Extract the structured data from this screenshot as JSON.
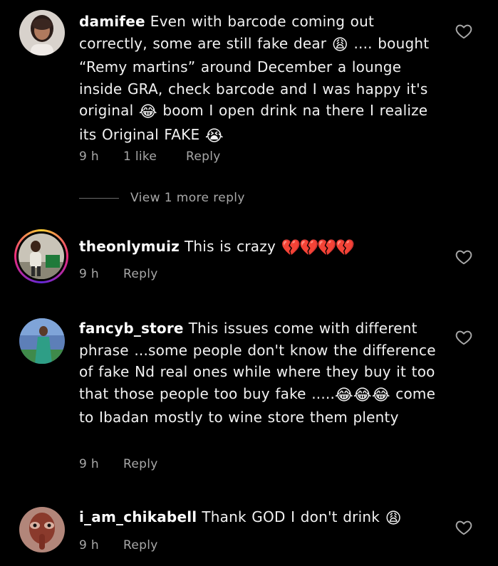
{
  "comments": [
    {
      "username": "damifee",
      "text": "Even with barcode coming out correctly, some are still fake dear",
      "emoji1": "😩",
      "text2": " .... bought “Remy martins” around December a lounge inside GRA, check barcode and I was happy it's original",
      "emoji2": "😂",
      "text3": " boom I open drink na there I realize its Original FAKE ",
      "emoji3": "😭",
      "time": "9 h",
      "likes": "1 like",
      "reply": "Reply"
    },
    {
      "username": "theonlymuiz",
      "text": "This is crazy ",
      "emoji1": "💔💔💔💔",
      "time": "9 h",
      "reply": "Reply"
    },
    {
      "username": "fancyb_store",
      "text": "This issues come with different phrase ...some people don't know the difference of fake Nd real ones while where they buy it too that those people too buy fake .....",
      "emoji1": "😂😂😂",
      "text2": " come to Ibadan mostly to wine store them plenty",
      "time": "9 h",
      "reply": "Reply"
    },
    {
      "username": "i_am_chikabell",
      "text": "Thank GOD I don't drink ",
      "emoji1": "😩",
      "time": "9 h",
      "reply": "Reply"
    }
  ],
  "view_replies": "View 1 more reply",
  "icons": {
    "like": "heart-outline-icon"
  },
  "colors": {
    "background": "#000000",
    "text": "#f2f2f2",
    "meta": "#a8a8a8",
    "story_ring": "#ee2a7b"
  }
}
